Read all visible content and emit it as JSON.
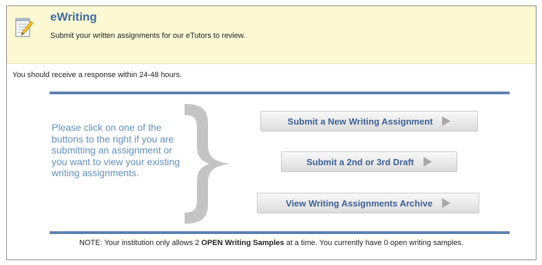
{
  "header": {
    "icon": "notepad-pencil-icon",
    "title": "eWriting",
    "subtitle": "Submit your written assignments for our eTutors to review."
  },
  "response_time": "You should receive a response within 24-48 hours.",
  "instructions": "Please click on one of the buttons to the right if you are submitting an assignment or you want to view your existing writing assignments.",
  "buttons": {
    "submit_new": "Submit a New Writing Assignment",
    "submit_draft": "Submit a 2nd or 3rd Draft",
    "view_archive": "View Writing Assignments Archive"
  },
  "note": {
    "prefix": "NOTE: Your institution only allows 2 ",
    "emphasis": "OPEN Writing Samples",
    "suffix": " at a time. You currently have 0 open writing samples."
  },
  "colors": {
    "header_bg": "#fbf8d3",
    "title": "#3f6aa3",
    "rule": "#5b7fb1",
    "instructions": "#5f8fbe",
    "button_text": "#3d6298"
  }
}
